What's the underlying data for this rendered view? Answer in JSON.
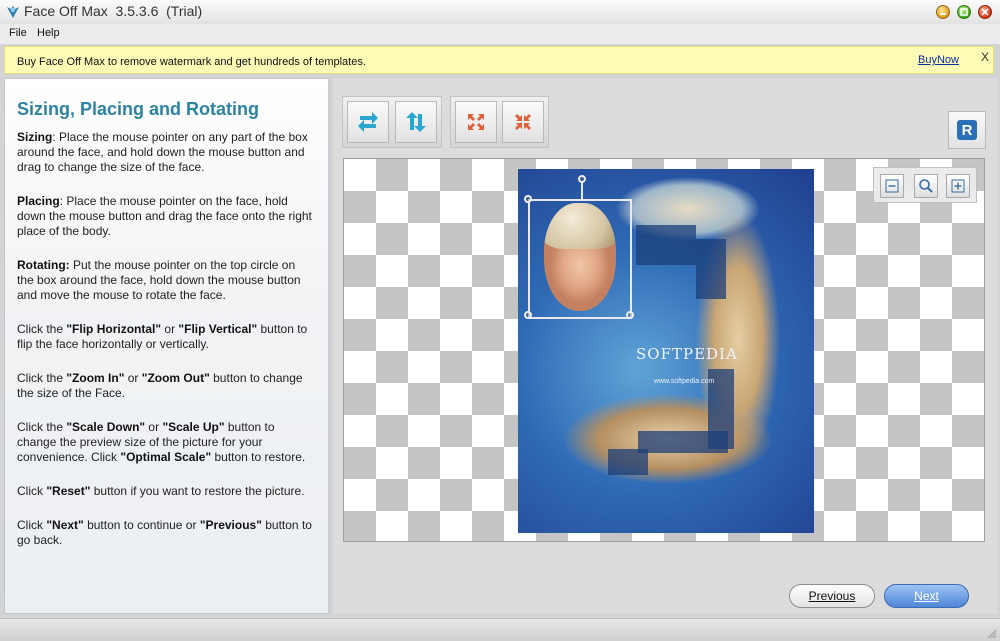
{
  "window": {
    "title": "Face Off Max  3.5.3.6  (Trial)"
  },
  "menu": {
    "file": "File",
    "help": "Help"
  },
  "banner": {
    "message": "Buy Face Off Max to remove watermark and get hundreds of templates.",
    "buy_now": "BuyNow",
    "close": "X"
  },
  "help": {
    "title": "Sizing, Placing and Rotating",
    "sizing_label": "Sizing",
    "sizing_text": ": Place the mouse pointer on any part of the box around the face, and hold down the mouse button and drag to change the size of the face.",
    "placing_label": "Placing",
    "placing_text": ": Place the mouse pointer on the face, hold down the mouse button and drag the face onto the right place of the body.",
    "rotating_label": "Rotating:",
    "rotating_text": " Put the mouse pointer on the top circle on the box around the face, hold down the mouse button and move the mouse to rotate the face.",
    "flip_1": "Click the ",
    "flip_h": "\"Flip Horizontal\"",
    "flip_or": " or ",
    "flip_v": "\"Flip Vertical\"",
    "flip_2": " button to flip the face horizontally or vertically.",
    "zoom_1": "Click the ",
    "zoom_in": "\"Zoom In\"",
    "zoom_or": " or ",
    "zoom_out": "\"Zoom Out\"",
    "zoom_2": " button to change the size of the Face.",
    "scale_1": "Click the ",
    "scale_down": "\"Scale Down\"",
    "scale_or": " or ",
    "scale_up": "\"Scale Up\"",
    "scale_2": " button to change the preview size of the picture for your convenience. Click ",
    "optimal": "\"Optimal Scale\"",
    "scale_3": " button to restore.",
    "reset_1": "Click ",
    "reset": "\"Reset\"",
    "reset_2": " button if you want to restore the picture.",
    "nav_1": "Click ",
    "next": "\"Next\"",
    "nav_2": " button to continue or ",
    "previous": "\"Previous\"",
    "nav_3": " button to go back."
  },
  "toolbar": {
    "reset_letter": "R",
    "icons": [
      "flip-horizontal-icon",
      "flip-vertical-icon",
      "zoom-in-face-icon",
      "zoom-out-face-icon",
      "reset-icon"
    ]
  },
  "preview": {
    "watermark": "SOFTPEDIA",
    "watermark_url": "www.softpedia.com",
    "zoom_icons": [
      "scale-down-icon",
      "optimal-scale-icon",
      "scale-up-icon"
    ]
  },
  "nav": {
    "previous": "Previous",
    "next": "Next"
  },
  "colors": {
    "title": "#2d83a3",
    "banner": "#fdfbb5",
    "next_button": "#4f86d8",
    "link": "#0a2ea6"
  }
}
